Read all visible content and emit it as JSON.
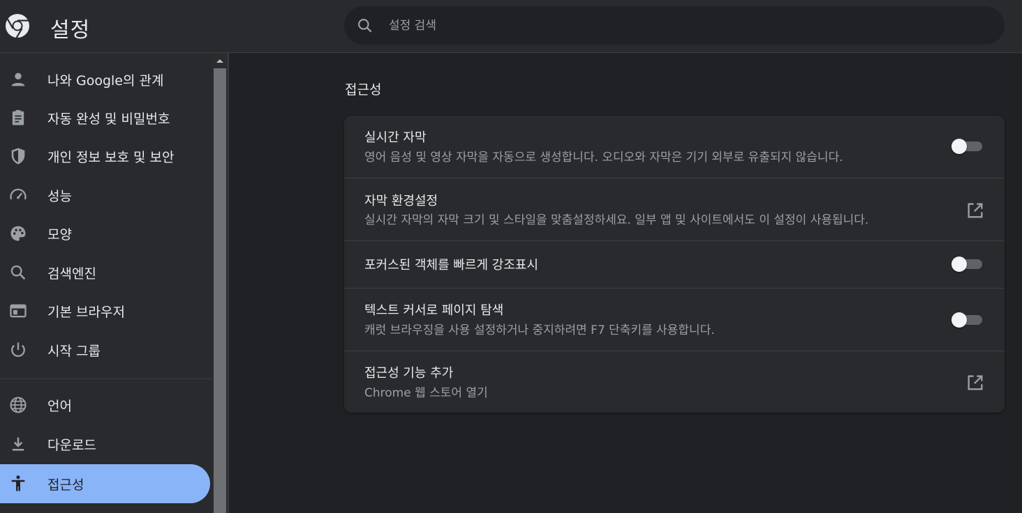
{
  "header": {
    "title": "설정",
    "search_placeholder": "설정 검색"
  },
  "sidebar": {
    "items": [
      {
        "label": "나와 Google의 관계",
        "icon": "person-icon"
      },
      {
        "label": "자동 완성 및 비밀번호",
        "icon": "clipboard-icon"
      },
      {
        "label": "개인 정보 보호 및 보안",
        "icon": "shield-icon"
      },
      {
        "label": "성능",
        "icon": "speedometer-icon"
      },
      {
        "label": "모양",
        "icon": "palette-icon"
      },
      {
        "label": "검색엔진",
        "icon": "search-icon"
      },
      {
        "label": "기본 브라우저",
        "icon": "browser-window-icon"
      },
      {
        "label": "시작 그룹",
        "icon": "power-icon"
      },
      {
        "label": "언어",
        "icon": "globe-icon"
      },
      {
        "label": "다운로드",
        "icon": "download-icon"
      },
      {
        "label": "접근성",
        "icon": "accessibility-icon",
        "active": true
      }
    ]
  },
  "main": {
    "section_title": "접근성",
    "rows": [
      {
        "title": "실시간 자막",
        "subtitle": "영어 음성 및 영상 자막을 자동으로 생성합니다. 오디오와 자막은 기기 외부로 유출되지 않습니다.",
        "control": "toggle",
        "on": false
      },
      {
        "title": "자막 환경설정",
        "subtitle": "실시간 자막의 자막 크기 및 스타일을 맞춤설정하세요. 일부 앱 및 사이트에서도 이 설정이 사용됩니다.",
        "control": "external-link-icon"
      },
      {
        "title": "포커스된 객체를 빠르게 강조표시",
        "control": "toggle",
        "on": false
      },
      {
        "title": "텍스트 커서로 페이지 탐색",
        "subtitle": "캐럿 브라우징을 사용 설정하거나 중지하려면 F7 단축키를 사용합니다.",
        "control": "toggle",
        "on": false
      },
      {
        "title": "접근성 기능 추가",
        "subtitle": "Chrome 웹 스토어 열기",
        "control": "external-link-icon"
      }
    ]
  },
  "colors": {
    "background": "#202124",
    "surface": "#292a2d",
    "accent": "#8ab4f8",
    "text_primary": "#e8eaed",
    "text_secondary": "#9aa0a6"
  }
}
